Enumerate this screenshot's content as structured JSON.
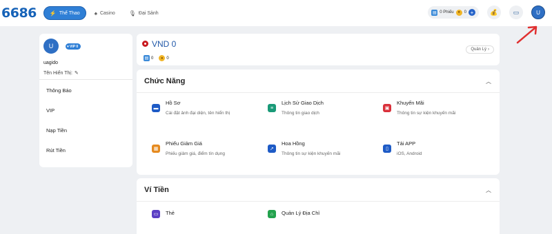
{
  "header": {
    "logo": "6686",
    "nav": [
      {
        "label": "Thể Thao",
        "icon": "lightning-icon",
        "active": true
      },
      {
        "label": "Casino",
        "icon": "spade-icon",
        "active": false
      },
      {
        "label": "Đại Sảnh",
        "icon": "microphone-icon",
        "active": false
      }
    ],
    "wallet": {
      "tickets": "0 Phiếu",
      "coins": "0"
    },
    "avatar_letter": "U"
  },
  "profile": {
    "avatar_letter": "U",
    "vip_label": "VIP 0",
    "username": "uagido",
    "display_name_label": "Tên Hiển Thị:",
    "menu": [
      "Thông Báo",
      "VIP",
      "Nạp Tiền",
      "Rút Tiền"
    ]
  },
  "balance": {
    "amount": "VND 0",
    "tickets": "0",
    "coins": "0",
    "manage_label": "Quản Lý"
  },
  "functions": {
    "title": "Chức Năng",
    "items": [
      {
        "title": "Hồ Sơ",
        "desc": "Cài đặt ảnh đại diện, tên hiển thị",
        "icon": "profile-card-icon",
        "color": "#1e5bc6"
      },
      {
        "title": "Lịch Sử Giao Dịch",
        "desc": "Thông tin giao dịch",
        "icon": "history-list-icon",
        "color": "#1a9a78"
      },
      {
        "title": "Khuyến Mãi",
        "desc": "Thông tin sự kiện khuyến mãi",
        "icon": "gift-icon",
        "color": "#d9303a"
      },
      {
        "title": "Phiếu Giảm Giá",
        "desc": "Phiếu giảm giá, điểm tín dụng",
        "icon": "coupon-icon",
        "color": "#e58a1f"
      },
      {
        "title": "Hoa Hồng",
        "desc": "Thông tin sự kiện khuyến mãi",
        "icon": "share-arrow-icon",
        "color": "#1e5bc6"
      },
      {
        "title": "Tải APP",
        "desc": "iOS, Android",
        "icon": "phone-icon",
        "color": "#1e5bc6"
      }
    ]
  },
  "wallet_section": {
    "title": "Ví Tiền",
    "items": [
      {
        "title": "Thẻ",
        "icon": "card-icon",
        "color": "#5b3fc4"
      },
      {
        "title": "Quản Lý Địa Chỉ",
        "icon": "address-icon",
        "color": "#23a24d"
      }
    ]
  },
  "colors": {
    "brand": "#2f7fd6",
    "accent_red": "#e03131",
    "page_bg": "#eef0f3"
  }
}
